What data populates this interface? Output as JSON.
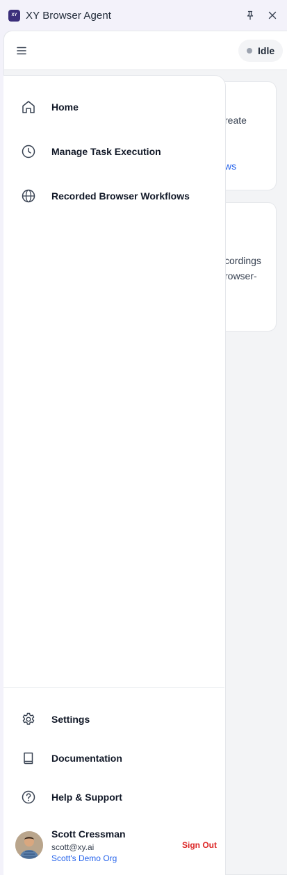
{
  "app": {
    "logo_text": "XY",
    "title": "XY Browser Agent"
  },
  "titlebar_icons": [
    "pin-icon",
    "close-icon"
  ],
  "header": {
    "menu_icon": "hamburger-icon",
    "status": "Idle"
  },
  "background_cards": [
    {
      "text_lines": [
        "reate"
      ],
      "link": "ws"
    },
    {
      "text_lines": [
        "cordings",
        "rowser-"
      ]
    }
  ],
  "nav": {
    "top_items": [
      {
        "label": "Home",
        "icon": "home-icon"
      },
      {
        "label": "Manage Task Execution",
        "icon": "clock-icon"
      },
      {
        "label": "Recorded Browser Workflows",
        "icon": "globe-icon"
      }
    ],
    "bottom_items": [
      {
        "label": "Settings",
        "icon": "gear-icon"
      },
      {
        "label": "Documentation",
        "icon": "book-icon"
      },
      {
        "label": "Help & Support",
        "icon": "help-circle-icon"
      }
    ]
  },
  "user": {
    "name": "Scott Cressman",
    "email": "scott@xy.ai",
    "org": "Scott's Demo Org",
    "sign_out": "Sign Out"
  },
  "colors": {
    "accent": "#2563eb",
    "danger": "#dc2626",
    "status_idle": "#9ca3af",
    "logo": "#3b2f7a"
  }
}
